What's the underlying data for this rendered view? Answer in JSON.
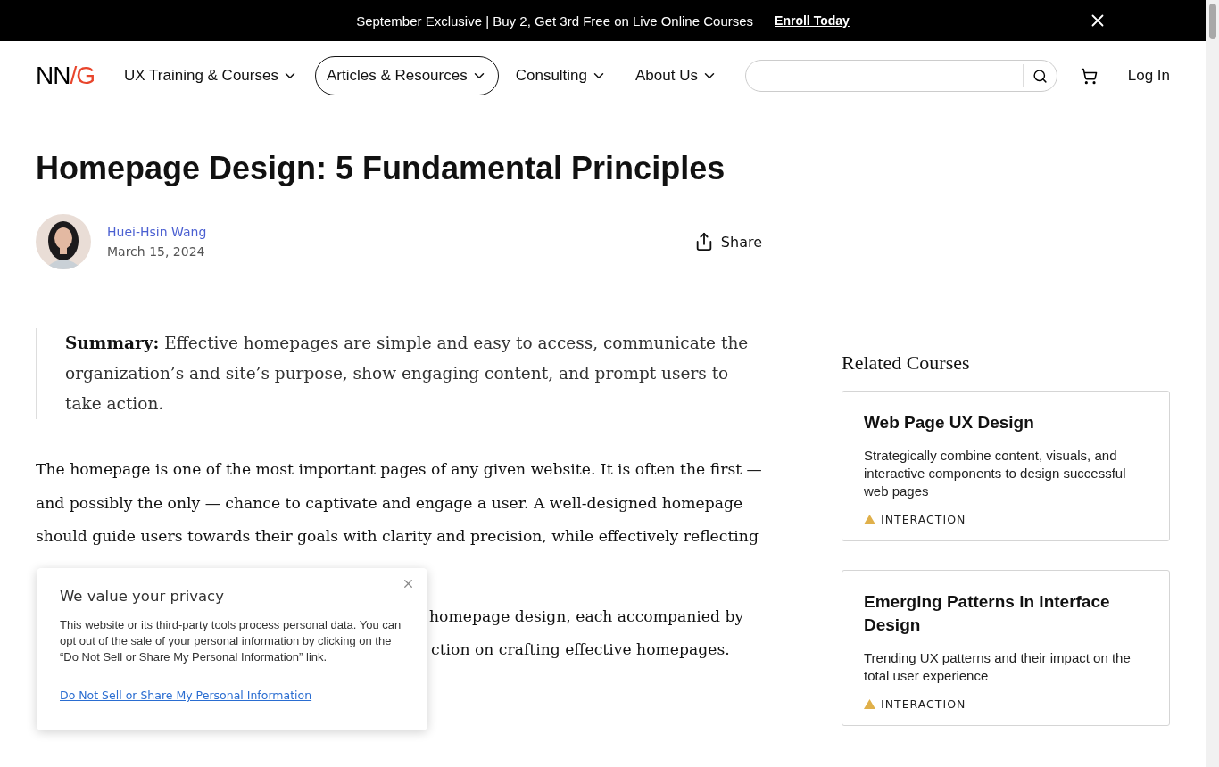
{
  "banner": {
    "text": "September Exclusive | Buy 2, Get 3rd Free on Live Online Courses",
    "link": "Enroll Today"
  },
  "nav": {
    "logo": [
      {
        "text": "NN",
        "color": "#000000"
      },
      {
        "text": "/G",
        "color": "#e8452c"
      }
    ],
    "items": [
      {
        "label": "UX Training & Courses",
        "selected": false
      },
      {
        "label": "Articles & Resources",
        "selected": true
      },
      {
        "label": "Consulting",
        "selected": false
      },
      {
        "label": "About Us",
        "selected": false
      }
    ],
    "login": "Log In"
  },
  "article": {
    "title": "Homepage Design: 5 Fundamental Principles",
    "author": "Huei-Hsin Wang",
    "date": "March 15, 2024",
    "share": "Share",
    "summary_label": "Summary:",
    "summary": "Effective homepages are simple and easy to access, communicate the organization’s and site’s purpose, show engaging content, and prompt users to take action.",
    "paragraph": "The homepage is one of the most important pages of any given website. It is often the first — and possibly the only — chance to captivate and engage a user. A well-designed homepage should guide users towards their goals with clarity and precision, while effectively reflecting",
    "partial_lines": [
      "homepage design, each accompanied by",
      "ction on crafting effective homepages."
    ]
  },
  "sidebar": {
    "heading": "Related Courses",
    "courses": [
      {
        "title": "Web Page UX Design",
        "description": "Strategically combine content, visuals, and interactive components to design successful web pages",
        "tag": "INTERACTION",
        "color": "#e0b04a"
      },
      {
        "title": "Emerging Patterns in Interface Design",
        "description": "Trending UX patterns and their impact on the total user experience",
        "tag": "INTERACTION",
        "color": "#e0b04a"
      }
    ]
  },
  "privacy": {
    "title": "We value your privacy",
    "body": "This website or its third-party tools process personal data. You can opt out of the sale of your personal information by clicking on the “Do Not Sell or Share My Personal Information” link.",
    "link": "Do Not Sell or Share My Personal Information"
  }
}
